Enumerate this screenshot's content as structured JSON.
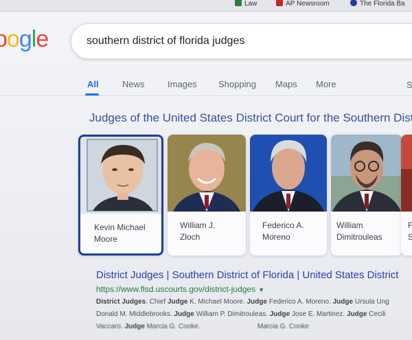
{
  "bookmarks": [
    {
      "label": "Law",
      "color": "#2f7d3b"
    },
    {
      "label": "AP Newsroom",
      "color": "#c62828"
    },
    {
      "label": "The Florida Ba",
      "color": "#1f3e9c"
    }
  ],
  "search": {
    "query": "southern district of florida judges"
  },
  "tabs": [
    "All",
    "News",
    "Images",
    "Shopping",
    "Maps",
    "More"
  ],
  "tabs_right": "S",
  "carousel": {
    "title": "Judges of the United States District Court for the Southern Dist",
    "judges": [
      {
        "line1": "Kevin Michael",
        "line2": "Moore"
      },
      {
        "line1": "William J.",
        "line2": "Zloch"
      },
      {
        "line1": "Federico A.",
        "line2": "Moreno"
      },
      {
        "line1": "William",
        "line2": "Dimitrouleas"
      },
      {
        "line1": "F",
        "line2": "Se"
      }
    ]
  },
  "result": {
    "title": "District Judges | Southern District of Florida | United States District",
    "url": "https://www.flsd.uscourts.gov/district-judges",
    "snippet_lines": [
      [
        {
          "t": "District Judges",
          "b": true
        },
        {
          "t": ". Chief ",
          "b": false
        },
        {
          "t": "Judge",
          "b": true
        },
        {
          "t": " K. Michael Moore. ",
          "b": false
        },
        {
          "t": "Judge",
          "b": true
        },
        {
          "t": " Federico A. Moreno. ",
          "b": false
        },
        {
          "t": "Judge",
          "b": true
        },
        {
          "t": " Ursula Ung",
          "b": false
        }
      ],
      [
        {
          "t": "Donald M. Middlebrooks. ",
          "b": false
        },
        {
          "t": "Judge",
          "b": true
        },
        {
          "t": " William P. Dimitrouleas. ",
          "b": false
        },
        {
          "t": "Judge",
          "b": true
        },
        {
          "t": " Jose E. Martinez. ",
          "b": false
        },
        {
          "t": "Judge",
          "b": true
        },
        {
          "t": " Cecili",
          "b": false
        }
      ],
      [
        {
          "t": "Vaccaro. ",
          "b": false
        },
        {
          "t": "Judge",
          "b": true
        },
        {
          "t": " Marcia G. Cooke.",
          "b": false
        },
        {
          "t": "                              Marcia G. Cooke",
          "b": false
        }
      ]
    ]
  },
  "colors": {
    "link": "#2a3fa8",
    "url": "#1e7d3a",
    "tab_active": "#1a73e8",
    "selected_border": "#1f3e9c"
  }
}
